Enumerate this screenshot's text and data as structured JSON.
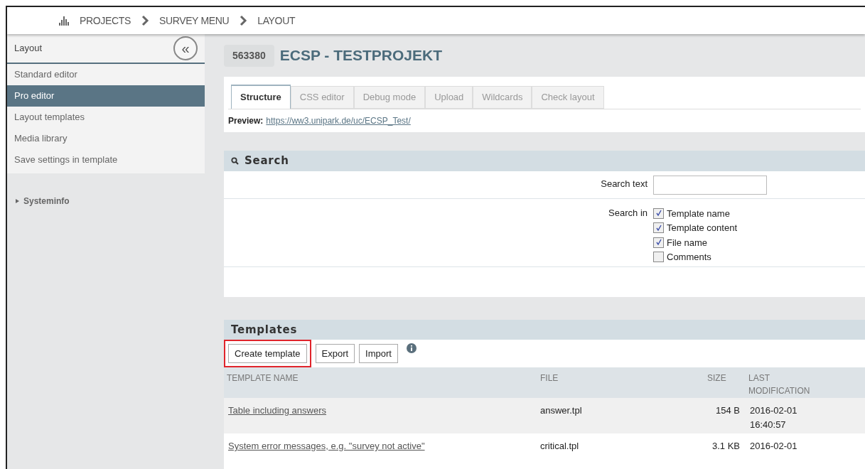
{
  "breadcrumb": [
    "PROJECTS",
    "SURVEY MENU",
    "LAYOUT"
  ],
  "sidebar": {
    "title": "Layout",
    "collapse_label": "«",
    "items": [
      {
        "label": "Standard editor",
        "selected": false
      },
      {
        "label": "Pro editor",
        "selected": true
      },
      {
        "label": "Layout templates",
        "selected": false
      },
      {
        "label": "Media library",
        "selected": false
      },
      {
        "label": "Save settings in template",
        "selected": false
      }
    ],
    "systeminfo": {
      "label": "Systeminfo",
      "expanded": false
    }
  },
  "project": {
    "id": "563380",
    "title": "ECSP - TESTPROJEKT"
  },
  "tabs": [
    {
      "label": "Structure",
      "selected": true
    },
    {
      "label": "CSS editor",
      "selected": false
    },
    {
      "label": "Debug mode",
      "selected": false
    },
    {
      "label": "Upload",
      "selected": false
    },
    {
      "label": "Wildcards",
      "selected": false
    },
    {
      "label": "Check layout",
      "selected": false
    }
  ],
  "preview": {
    "label": "Preview:",
    "url": "https://ww3.unipark.de/uc/ECSP_Test/"
  },
  "search": {
    "title": "Search",
    "text_label": "Search text",
    "in_label": "Search in",
    "options": [
      {
        "label": "Template name",
        "checked": true
      },
      {
        "label": "Template content",
        "checked": true
      },
      {
        "label": "File name",
        "checked": true
      },
      {
        "label": "Comments",
        "checked": false
      }
    ]
  },
  "templates": {
    "title": "Templates",
    "buttons": [
      {
        "label": "Create template",
        "highlighted": true
      },
      {
        "label": "Export",
        "highlighted": false
      },
      {
        "label": "Import",
        "highlighted": false
      }
    ],
    "columns": [
      "TEMPLATE NAME",
      "FILE",
      "SIZE",
      "LAST MODIFICATION"
    ],
    "rows": [
      {
        "name": "Table including answers",
        "file": "answer.tpl",
        "size": "154 B",
        "modified": [
          "2016-02-01",
          "16:40:57"
        ]
      },
      {
        "name": "System error messages, e.g. \"survey not active\"",
        "file": "critical.tpl",
        "size": "3.1 KB",
        "modified": [
          "2016-02-01"
        ]
      }
    ]
  }
}
